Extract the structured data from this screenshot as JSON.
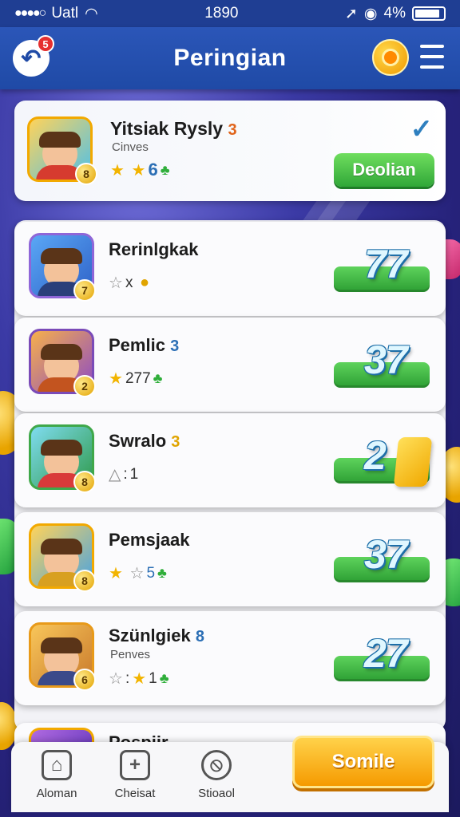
{
  "status_bar": {
    "carrier": "Uatl",
    "time": "1890",
    "battery": "4%"
  },
  "header": {
    "title": "Peringian",
    "notification_count": "5"
  },
  "featured": {
    "name": "Yitsiak Rysly",
    "name_badge": "3",
    "subtitle": "Cinves",
    "level": "8",
    "stats": "6",
    "action_label": "Deolian"
  },
  "rows": [
    {
      "name": "Rerinlgkak",
      "name_badge": "",
      "subtitle": "",
      "level": "7",
      "stats": "x",
      "score": "77"
    },
    {
      "name": "Pemlic",
      "name_badge": "3",
      "subtitle": "",
      "level": "2",
      "stats": "277",
      "score": "37"
    },
    {
      "name": "Swralo",
      "name_badge": "3",
      "subtitle": "",
      "level": "8",
      "stats": "1",
      "score": "2"
    },
    {
      "name": "Pemsjaak",
      "name_badge": "",
      "subtitle": "",
      "level": "8",
      "stats": "5",
      "score": "37"
    },
    {
      "name": "Szünlgiek",
      "name_badge": "8",
      "subtitle": "Penves",
      "level": "6",
      "stats": "1",
      "score": "27"
    }
  ],
  "peek_row": {
    "name": "Pospiir"
  },
  "bottom_nav": {
    "items": [
      {
        "label": "Aloman",
        "icon": "home-icon"
      },
      {
        "label": "Cheisat",
        "icon": "plus-icon"
      },
      {
        "label": "Stioaol",
        "icon": "block-icon"
      }
    ],
    "cta_label": "Somile"
  },
  "colors": {
    "header": "#1f4aa6",
    "score_bar": "#2c9e33",
    "cta": "#f59a00"
  }
}
